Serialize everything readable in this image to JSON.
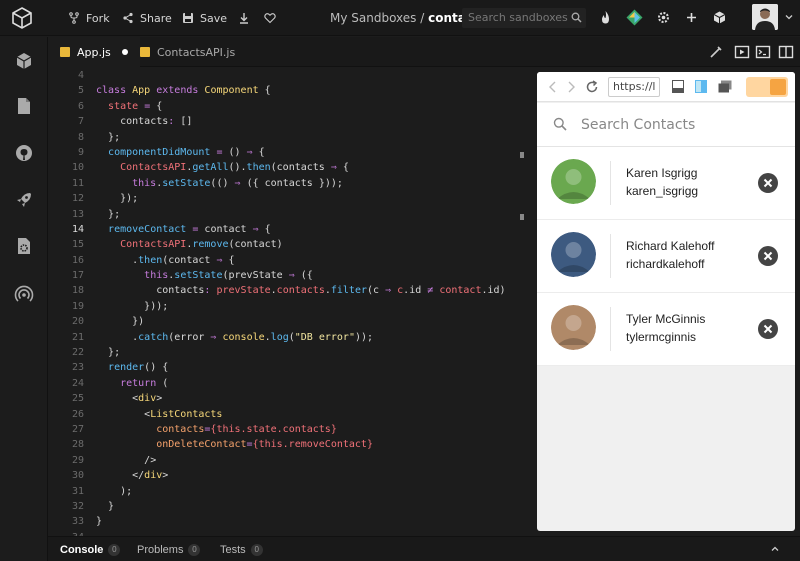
{
  "topbar": {
    "fork_label": "Fork",
    "share_label": "Share",
    "save_label": "Save",
    "breadcrumb_parent": "My Sandboxes /",
    "breadcrumb_current": "contacts-app",
    "search_placeholder": "Search sandboxes"
  },
  "activity_icons": [
    "cube-icon",
    "file-icon",
    "github-icon",
    "rocket-icon",
    "config-icon",
    "live-icon"
  ],
  "tabs": [
    {
      "label": "App.js",
      "active": true,
      "unsaved": true
    },
    {
      "label": "ContactsAPI.js",
      "active": false,
      "unsaved": false
    }
  ],
  "editor": {
    "current_line": 14,
    "lines": [
      {
        "n": "4",
        "html": ""
      },
      {
        "n": "5",
        "html": "<span class='kw'>class</span> <span class='cl'>App</span> <span class='kw'>extends</span> <span class='cl'>Component</span> <span class='pl'>{</span>"
      },
      {
        "n": "6",
        "html": "  <span class='tg'>state</span> <span class='kw'>=</span> <span class='pl'>{</span>"
      },
      {
        "n": "7",
        "html": "    <span class='pl'>contacts</span><span class='kw'>:</span> <span class='pl'>[]</span>"
      },
      {
        "n": "8",
        "html": "  <span class='pl'>};</span>"
      },
      {
        "n": "9",
        "html": "  <span class='fn'>componentDidMount</span> <span class='kw'>=</span> <span class='pl'>()</span> <span class='kw'>⇒</span> <span class='pl'>{</span>"
      },
      {
        "n": "10",
        "html": "    <span class='tg'>ContactsAPI</span><span class='pl'>.</span><span class='fn'>getAll</span><span class='pl'>().</span><span class='fn'>then</span><span class='pl'>(contacts</span> <span class='kw'>⇒</span> <span class='pl'>{</span>"
      },
      {
        "n": "11",
        "html": "      <span class='th'>this</span><span class='pl'>.</span><span class='fn'>setState</span><span class='pl'>(()</span> <span class='kw'>⇒</span> <span class='pl'>({ contacts }));</span>"
      },
      {
        "n": "12",
        "html": "    <span class='pl'>});</span>"
      },
      {
        "n": "13",
        "html": "  <span class='pl'>};</span>"
      },
      {
        "n": "14",
        "html": "  <span class='fn'>removeContact</span> <span class='kw'>=</span> <span class='pl'>contact</span> <span class='kw'>⇒</span> <span class='pl'>{</span>"
      },
      {
        "n": "15",
        "html": "    <span class='tg'>ContactsAPI</span><span class='pl'>.</span><span class='fn'>remove</span><span class='pl'>(contact)</span>"
      },
      {
        "n": "16",
        "html": "      <span class='pl'>.</span><span class='fn'>then</span><span class='pl'>(contact</span> <span class='kw'>⇒</span> <span class='pl'>{</span>"
      },
      {
        "n": "17",
        "html": "        <span class='th'>this</span><span class='pl'>.</span><span class='fn'>setState</span><span class='pl'>(prevState</span> <span class='kw'>⇒</span> <span class='pl'>({</span>"
      },
      {
        "n": "18",
        "html": "          <span class='pl'>contacts</span><span class='kw'>:</span> <span class='tg'>prevState</span><span class='pl'>.</span><span class='tg'>contacts</span><span class='pl'>.</span><span class='fn'>filter</span><span class='pl'>(c</span> <span class='kw'>⇒</span> <span class='tg'>c</span><span class='pl'>.id</span> <span class='kw'>≠</span> <span class='tg'>contact</span><span class='pl'>.id)</span>"
      },
      {
        "n": "19",
        "html": "        <span class='pl'>}));</span>"
      },
      {
        "n": "20",
        "html": "      <span class='pl'>})</span>"
      },
      {
        "n": "21",
        "html": "      <span class='pl'>.</span><span class='fn'>catch</span><span class='pl'>(error</span> <span class='kw'>⇒</span> <span class='cl'>console</span><span class='pl'>.</span><span class='fn'>log</span><span class='pl'>(</span><span class='st'>\"DB error\"</span><span class='pl'>));</span>"
      },
      {
        "n": "22",
        "html": "  <span class='pl'>};</span>"
      },
      {
        "n": "23",
        "html": "  <span class='fn'>render</span><span class='pl'>() {</span>"
      },
      {
        "n": "24",
        "html": "    <span class='kw'>return</span> <span class='pl'>(</span>"
      },
      {
        "n": "25",
        "html": "      <span class='pl'>&lt;</span><span class='cl'>div</span><span class='pl'>&gt;</span>"
      },
      {
        "n": "26",
        "html": "        <span class='pl'>&lt;</span><span class='cl'>ListContacts</span>"
      },
      {
        "n": "27",
        "html": "          <span class='att'>contacts</span><span class='kw'>=</span><span class='tg'>{this.state.contacts}</span>"
      },
      {
        "n": "28",
        "html": "          <span class='att'>onDeleteContact</span><span class='kw'>=</span><span class='tg'>{this.removeContact}</span>"
      },
      {
        "n": "29",
        "html": "        <span class='pl'>/&gt;</span>"
      },
      {
        "n": "30",
        "html": "      <span class='pl'>&lt;/</span><span class='cl'>div</span><span class='pl'>&gt;</span>"
      },
      {
        "n": "31",
        "html": "    <span class='pl'>);</span>"
      },
      {
        "n": "32",
        "html": "  <span class='pl'>}</span>"
      },
      {
        "n": "33",
        "html": "<span class='pl'>}</span>"
      },
      {
        "n": "34",
        "html": ""
      }
    ]
  },
  "preview": {
    "url": "https://l",
    "search_placeholder": "Search Contacts",
    "contacts": [
      {
        "name": "Karen Isgrigg",
        "handle": "karen_isgrigg",
        "avatar_color": "#6aa84f"
      },
      {
        "name": "Richard Kalehoff",
        "handle": "richardkalehoff",
        "avatar_color": "#3d5a80"
      },
      {
        "name": "Tyler McGinnis",
        "handle": "tylermcginnis",
        "avatar_color": "#b08968"
      }
    ]
  },
  "console": {
    "tabs": [
      {
        "label": "Console",
        "count": "0",
        "active": true
      },
      {
        "label": "Problems",
        "count": "0",
        "active": false
      },
      {
        "label": "Tests",
        "count": "0",
        "active": false
      }
    ]
  },
  "colors": {
    "accent_toggle": "#f5a442",
    "bg": "#1c1c1c"
  }
}
